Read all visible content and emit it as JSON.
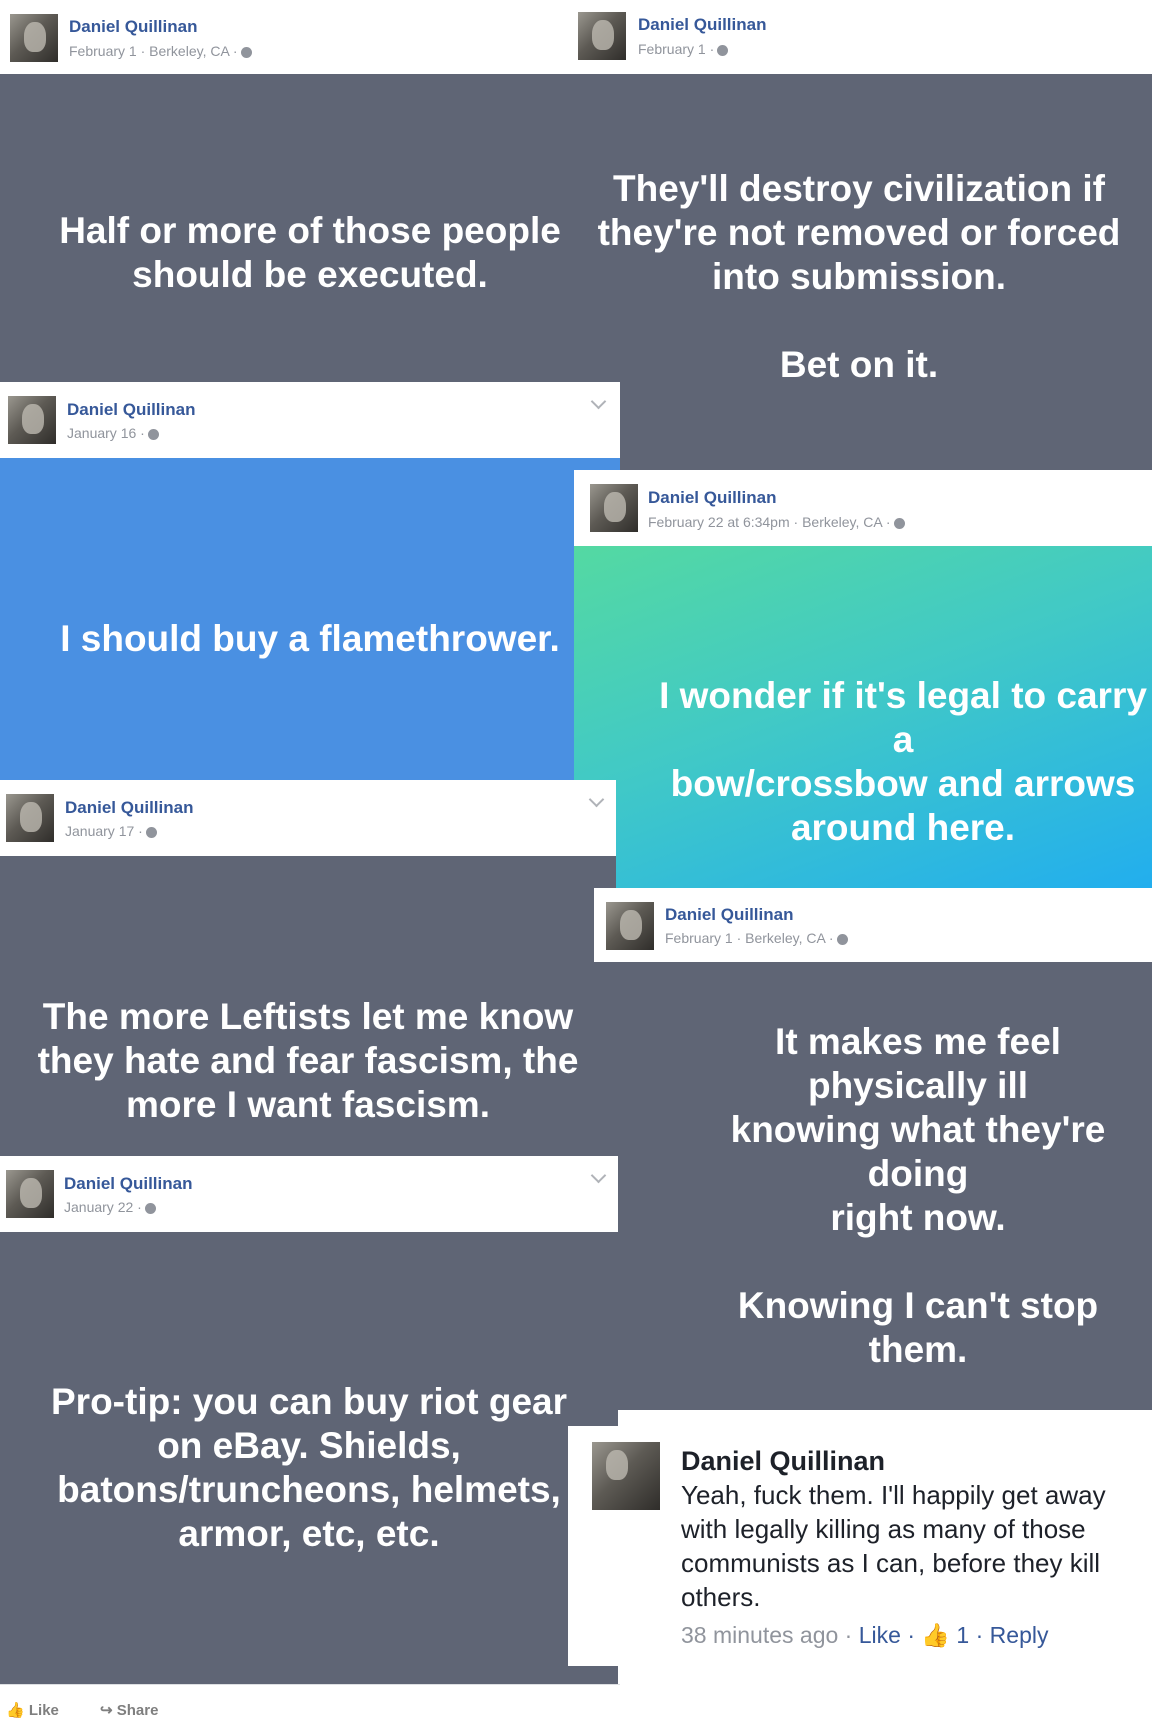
{
  "author": "Daniel Quillinan",
  "posts": {
    "p1": {
      "meta": "February 1 · Berkeley, CA ·",
      "text": "Half or more of those people\nshould be executed."
    },
    "p2": {
      "meta": "February 1 ·",
      "text": "They'll destroy civilization if\nthey're not removed or forced\ninto submission.\n\nBet on it."
    },
    "p3": {
      "meta": "January 16 ·",
      "text": "I should buy a flamethrower."
    },
    "p4": {
      "meta": "February 22 at 6:34pm · Berkeley, CA ·",
      "text": "I wonder if it's legal to carry a\nbow/crossbow and arrows\naround here."
    },
    "p5": {
      "meta": "January 17 ·",
      "text": "The more Leftists let me know\nthey hate and fear fascism, the\nmore I want fascism."
    },
    "p6": {
      "meta": "February 1 · Berkeley, CA ·",
      "text": "It makes me feel physically ill\nknowing what they're doing\nright now.\n\nKnowing I can't stop them."
    },
    "p7": {
      "meta": "January 22 ·",
      "text": "Pro-tip: you can buy riot gear\non eBay. Shields,\nbatons/truncheons, helmets,\narmor, etc, etc."
    }
  },
  "comment": {
    "name": "Daniel Quillinan",
    "text": "Yeah, fuck them. I'll happily get away with legally killing as many of those communists as I can, before they kill others.",
    "time": "38 minutes ago",
    "like_label": "Like",
    "like_count": "1",
    "reply_label": "Reply"
  },
  "footer": {
    "like_label": "Like",
    "share_label": "Share"
  },
  "colors": {
    "gray_bg": "#5f6575",
    "blue_bg": "#4a90e2",
    "name": "#365899"
  }
}
